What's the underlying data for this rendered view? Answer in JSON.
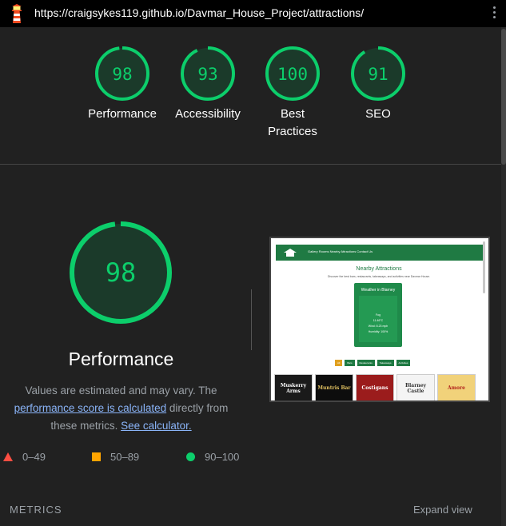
{
  "topbar": {
    "url": "https://craigsykes119.github.io/Davmar_House_Project/attractions/",
    "logo_icon": "lighthouse-icon",
    "menu_icon": "kebab-menu-icon"
  },
  "colors": {
    "pass": "#0cce6b",
    "average": "#ffa400",
    "fail": "#ff4e42",
    "background": "#212121"
  },
  "scores": [
    {
      "value": "98",
      "label": "Performance"
    },
    {
      "value": "93",
      "label": "Accessibility"
    },
    {
      "value": "100",
      "label": "Best Practices"
    },
    {
      "value": "91",
      "label": "SEO"
    }
  ],
  "performance": {
    "score": "98",
    "title": "Performance",
    "desc_prefix": "Values are estimated and may vary. The ",
    "link_score": "performance score is calculated",
    "desc_middle": " directly from these metrics. ",
    "link_calculator": "See calculator."
  },
  "legend": [
    {
      "shape": "triangle",
      "range": "0–49"
    },
    {
      "shape": "square",
      "range": "50–89"
    },
    {
      "shape": "circle",
      "range": "90–100"
    }
  ],
  "screenshot": {
    "nav_links": "Gallery   Rooms   Nearby Attractions   Contact Us",
    "heading": "Nearby Attractions",
    "subheading": "Discover the best bars, restaurants, takeaways, and activities near Davmar House.",
    "weather_title": "Weather in Blarney",
    "weather_lines": [
      "Fog",
      "11.46°C",
      "Wind: 8.23 mph",
      "Humidity: 100%"
    ],
    "filter_buttons": [
      "All",
      "Bars",
      "Restaurants",
      "Takeaways",
      "Activities"
    ],
    "tiles": [
      "Muskerry Arms",
      "Muntris Bar",
      "Costigans",
      "Blarney Castle",
      "Amore"
    ]
  },
  "footer": {
    "metrics_label": "METRICS",
    "expand_label": "Expand view"
  }
}
